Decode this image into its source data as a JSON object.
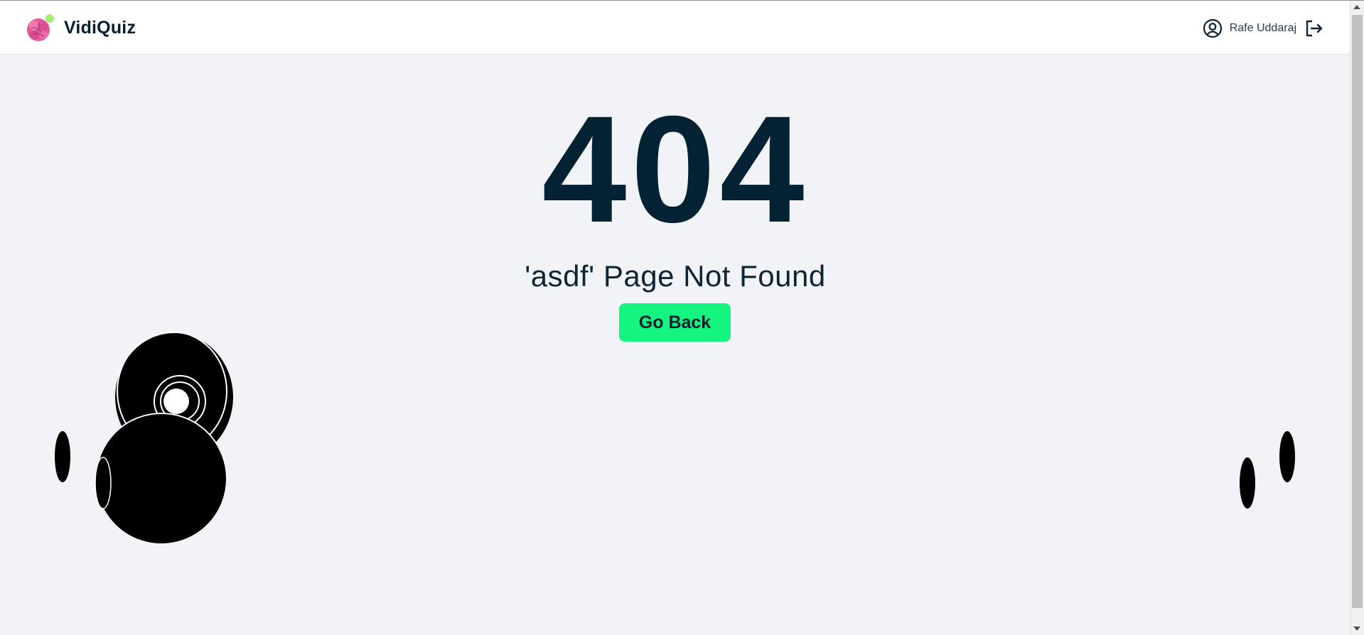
{
  "app": {
    "name": "VidiQuiz",
    "logo_icon": "brain-icon"
  },
  "header": {
    "user_name": "Rafe Uddaraj",
    "user_icon": "user-circle-icon",
    "logout_icon": "logout-icon"
  },
  "error": {
    "code": "404",
    "message": "'asdf' Page Not Found",
    "back_label": "Go Back"
  },
  "colors": {
    "accent": "#13f57f",
    "text_dark": "#032233",
    "background": "#f1f3f6"
  }
}
